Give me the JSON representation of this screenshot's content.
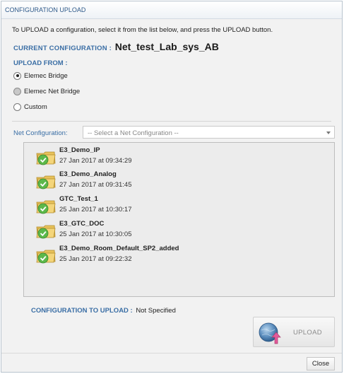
{
  "dialog": {
    "title": "CONFIGURATION UPLOAD",
    "instruction": "To UPLOAD a configuration, select it from the list below, and press the UPLOAD button.",
    "current_label": "CURRENT CONFIGURATION :",
    "current_value": "Net_test_Lab_sys_AB",
    "upload_from_label": "UPLOAD FROM :"
  },
  "upload_from": {
    "options": [
      {
        "label": "Elemec Bridge",
        "state": "selected"
      },
      {
        "label": "Elemec Net Bridge",
        "state": "disabled"
      },
      {
        "label": "Custom",
        "state": "unselected"
      }
    ]
  },
  "net_config": {
    "label": "Net Configuration:",
    "placeholder": "-- Select a Net Configuration --"
  },
  "configurations": [
    {
      "name": "E3_Demo_IP",
      "date": "27 Jan 2017 at 09:34:29",
      "icon": "folder-check-icon"
    },
    {
      "name": "E3_Demo_Analog",
      "date": "27 Jan 2017 at 09:31:45",
      "icon": "folder-check-icon"
    },
    {
      "name": "GTC_Test_1",
      "date": "25 Jan 2017 at 10:30:17",
      "icon": "folder-check-icon"
    },
    {
      "name": "E3_GTC_DOC",
      "date": "25 Jan 2017 at 10:30:05",
      "icon": "folder-check-icon"
    },
    {
      "name": "E3_Demo_Room_Default_SP2_added",
      "date": "25 Jan 2017 at 09:22:32",
      "icon": "folder-check-icon"
    }
  ],
  "to_upload": {
    "label": "CONFIGURATION TO UPLOAD :",
    "value": "Not Specified"
  },
  "buttons": {
    "upload": "UPLOAD",
    "close": "Close"
  },
  "colors": {
    "accent_blue": "#3a6ea5",
    "title_blue": "#2f5a8a",
    "list_bg": "#ececec"
  }
}
